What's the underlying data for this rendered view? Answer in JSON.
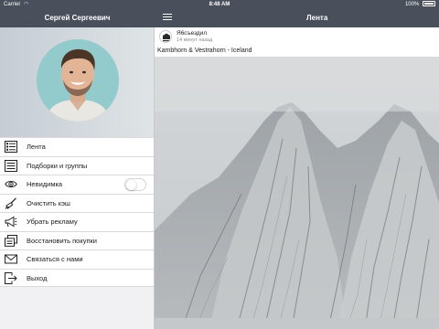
{
  "status_bar": {
    "carrier": "Carrier",
    "time": "8:48 AM",
    "battery": "100%"
  },
  "nav": {
    "user_name": "Сергей Сергеевич",
    "feed_title": "Лента"
  },
  "menu": {
    "items": [
      {
        "label": "Лента",
        "icon": "feed-list-icon"
      },
      {
        "label": "Подборки и группы",
        "icon": "lines-icon"
      },
      {
        "label": "Невидимка",
        "icon": "eye-icon",
        "toggle": false
      },
      {
        "label": "Очистить кэш",
        "icon": "broom-icon"
      },
      {
        "label": "Убрать рекламу",
        "icon": "megaphone-icon"
      },
      {
        "label": "Восстановить покупки",
        "icon": "restore-icon"
      },
      {
        "label": "Связаться с нами",
        "icon": "envelope-icon"
      },
      {
        "label": "Выход",
        "icon": "exit-icon"
      }
    ]
  },
  "post": {
    "author": "Я6съездил",
    "time": "14 минут назад",
    "text": "Kambhorn & Vestrahorn - Iceland"
  },
  "colors": {
    "nav_background": "#4a4f5c",
    "sidebar_background": "#f1f1f4"
  }
}
